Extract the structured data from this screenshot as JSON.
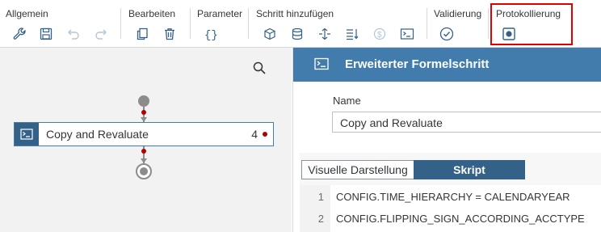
{
  "toolbar": {
    "groups": {
      "allgemein": "Allgemein",
      "bearbeiten": "Bearbeiten",
      "parameter": "Parameter",
      "schritt": "Schritt hinzufügen",
      "validierung": "Validierung",
      "protokollierung": "Protokollierung"
    },
    "icons": [
      "wrench-icon",
      "save-icon",
      "undo-icon",
      "redo-icon",
      "copy-icon",
      "delete-icon",
      "braces-icon",
      "add-step-cube-icon",
      "add-step-stack-icon",
      "add-step-move-icon",
      "add-step-list-icon",
      "currency-icon",
      "formula-step-icon",
      "check-circle-icon",
      "record-icon"
    ]
  },
  "canvas": {
    "step": {
      "label": "Copy and Revaluate",
      "count": "4"
    }
  },
  "panel": {
    "title": "Erweiterter Formelschritt",
    "name_label": "Name",
    "name_value": "Copy and Revaluate",
    "tabs": {
      "visual": "Visuelle Darstellung",
      "script": "Skript",
      "active": "Skript"
    },
    "code_lines": [
      {
        "num": "1",
        "text": "CONFIG.TIME_HIERARCHY = CALENDARYEAR"
      },
      {
        "num": "2",
        "text": "CONFIG.FLIPPING_SIGN_ACCORDING_ACCTYPE"
      }
    ]
  },
  "colors": {
    "header": "#427cac",
    "accent_dark": "#346187",
    "highlight_box": "#e00000",
    "connector_dot": "#b00000"
  }
}
